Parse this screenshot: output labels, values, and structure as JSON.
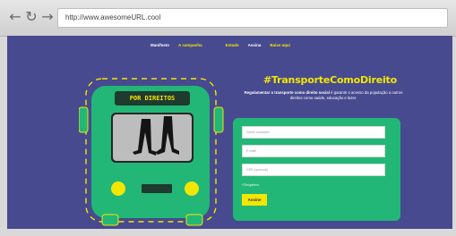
{
  "browser": {
    "back_icon": "arrow-left-icon",
    "reload_icon": "reload-icon",
    "forward_icon": "arrow-right-icon",
    "url": "http://www.awesomeURL.cool"
  },
  "nav": {
    "items": [
      {
        "label": "Manifesto",
        "color": "#ffffff"
      },
      {
        "label": "A campanha",
        "color": "#f3e600"
      },
      {
        "label": "Estado",
        "color": "#f3e600"
      },
      {
        "label": "Assina",
        "color": "#ffffff"
      },
      {
        "label": "Baixe aqui",
        "color": "#f3e600"
      }
    ]
  },
  "hero": {
    "hashtag": "#TransporteComoDireito",
    "lead_bold": "Regulamentar o transporte como direito social",
    "lead_rest": " é garantir o acesso da população a outros direitos como saúde, educação e lazer."
  },
  "bus": {
    "sign_text": "POR DIREITOS",
    "body_color": "#22b776",
    "accent_color": "#f3e600"
  },
  "form": {
    "name_placeholder": "Nome completo*",
    "email_placeholder": "E-mail*",
    "cep_placeholder": "CEP (opcional)",
    "required_note": "*Obrigatório",
    "submit_label": "Assine"
  },
  "colors": {
    "page_bg": "#474a8f",
    "accent": "#f3e600",
    "green": "#22b776"
  }
}
